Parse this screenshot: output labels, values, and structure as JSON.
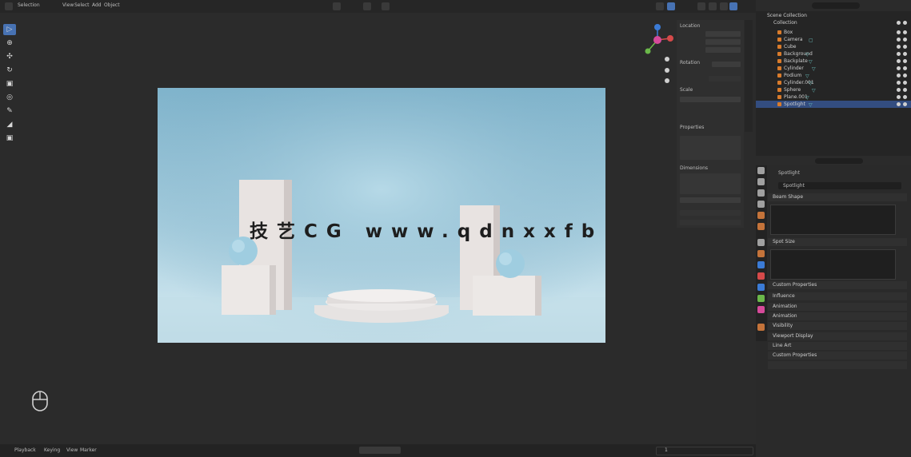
{
  "header": {
    "menus": [
      "Selection",
      "View",
      "Select",
      "Add",
      "Object"
    ],
    "watermark": "技艺CG  www.qdnxxfb"
  },
  "toolbar": {
    "tools": [
      "select-box",
      "cursor",
      "move",
      "rotate",
      "scale",
      "transform",
      "annotate",
      "measure",
      "add-cube"
    ],
    "active_tool": "select-box"
  },
  "npanel": {
    "labels": [
      "Location",
      "Rotation",
      "Scale",
      "Dimensions"
    ],
    "section_title": "Properties"
  },
  "bottombar": {
    "left_text": [
      "Playback",
      "Keying",
      "View",
      "Marker"
    ],
    "frame": "1"
  },
  "outliner": {
    "title": "Scene Collection",
    "collection": "Collection",
    "items": [
      {
        "name": "Box"
      },
      {
        "name": "Camera"
      },
      {
        "name": "Cube"
      },
      {
        "name": "Background"
      },
      {
        "name": "Backplate"
      },
      {
        "name": "Cylinder"
      },
      {
        "name": "Podium"
      },
      {
        "name": "Cylinder.001"
      },
      {
        "name": "Sphere"
      },
      {
        "name": "Plane.001"
      },
      {
        "name": "Spotlight"
      }
    ],
    "selected_index": 10
  },
  "properties": {
    "object_name": "Spotlight",
    "sections": [
      "Beam Shape",
      "Spot Size",
      "Custom Properties",
      "Influence",
      "Animation",
      "Animation",
      "Visibility",
      "Viewport Display",
      "Line Art",
      "Custom Properties"
    ]
  },
  "colors": {
    "accent": "#4772b3",
    "selection": "#334d80",
    "render_bg": "#a9cfdf"
  }
}
